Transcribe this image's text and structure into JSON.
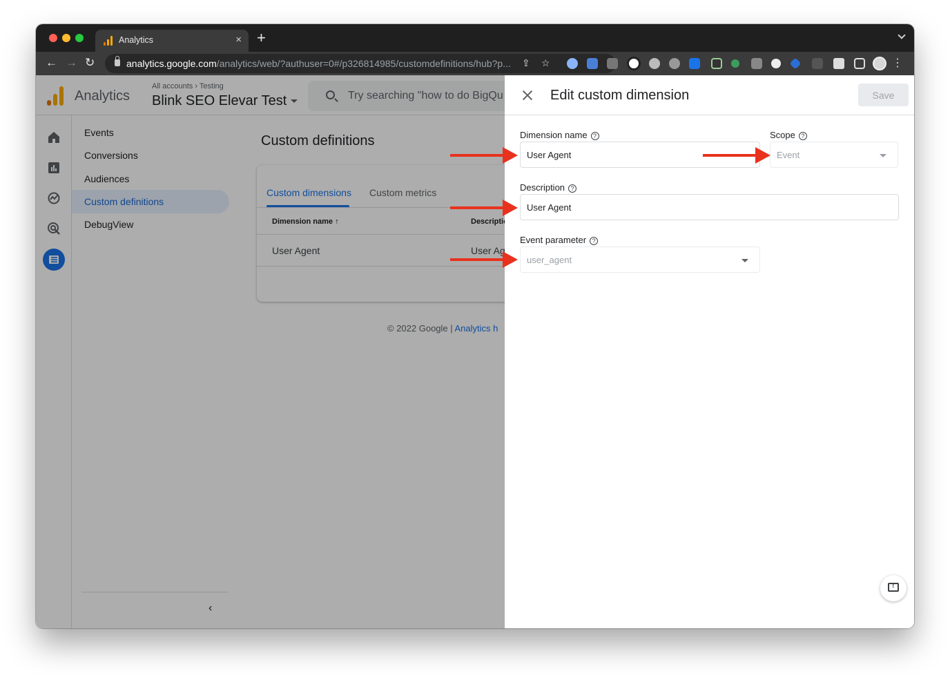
{
  "browser": {
    "tab_title": "Analytics",
    "tab_close": "×",
    "new_tab": "+",
    "url_host": "analytics.google.com",
    "url_path": "/analytics/web/?authuser=0#/p326814985/customdefinitions/hub?p...",
    "back": "←",
    "forward": "→",
    "reload": "↻",
    "share_icon": "⇪",
    "bookmark_icon": "☆",
    "menu": "⋮"
  },
  "header": {
    "app_name": "Analytics",
    "breadcrumb_account": "All accounts",
    "breadcrumb_sep": "›",
    "breadcrumb_child": "Testing",
    "property_name": "Blink SEO Elevar Test",
    "search_placeholder": "Try searching \"how to do BigQu"
  },
  "subnav": {
    "items": [
      {
        "label": "Events"
      },
      {
        "label": "Conversions"
      },
      {
        "label": "Audiences"
      },
      {
        "label": "Custom definitions"
      },
      {
        "label": "DebugView"
      }
    ],
    "collapse": "‹"
  },
  "main": {
    "page_title": "Custom definitions",
    "tabs": [
      {
        "label": "Custom dimensions"
      },
      {
        "label": "Custom metrics"
      }
    ],
    "columns": [
      {
        "label": "Dimension name",
        "sort": "↑"
      },
      {
        "label": "Descriptic"
      }
    ],
    "rows": [
      {
        "name": "User Agent",
        "description": "User Ag"
      }
    ],
    "footer_text": "© 2022 Google | ",
    "footer_link": "Analytics h"
  },
  "panel": {
    "title": "Edit custom dimension",
    "save_label": "Save",
    "dimension_name_label": "Dimension name",
    "dimension_name_value": "User Agent",
    "scope_label": "Scope",
    "scope_value": "Event",
    "description_label": "Description",
    "description_value": "User Agent",
    "event_parameter_label": "Event parameter",
    "event_parameter_value": "user_agent",
    "help_glyph": "?"
  },
  "colors": {
    "accent": "#1a73e8",
    "annotation_arrow": "#e8321e",
    "logo": [
      "#e37400",
      "#f9ab00",
      "#f9ab00"
    ]
  }
}
